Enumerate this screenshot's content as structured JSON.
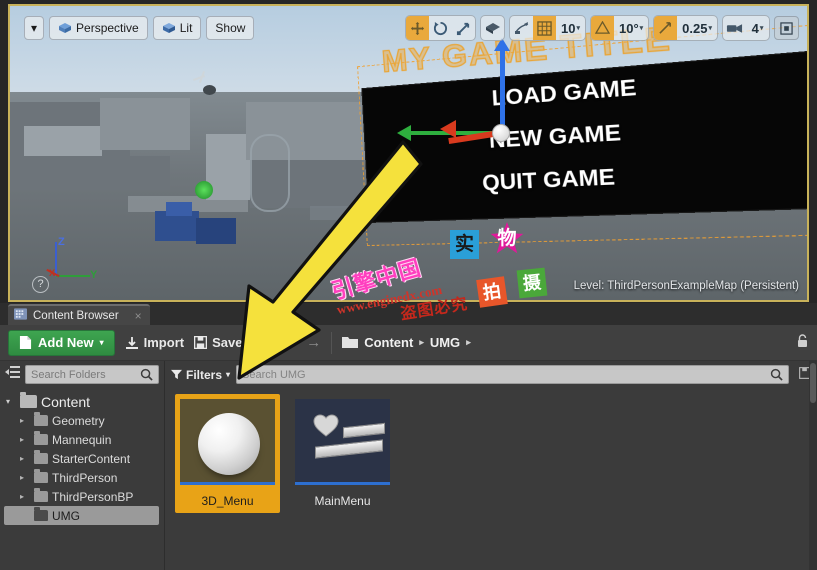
{
  "viewport": {
    "toolbar_left": {
      "dropdown_label": "▾",
      "perspective_label": "Perspective",
      "lit_label": "Lit",
      "show_label": "Show"
    },
    "toolbar_right": {
      "select_mode_icon": "move-tool-icon",
      "rotate_icon": "rotate-tool-icon",
      "scale_icon": "scale-tool-icon",
      "coord_space_icon": "world-space-icon",
      "surface_snap_icon": "surface-snap-icon",
      "grid_snap_icon": "grid-snap-icon",
      "grid_snap_value": "10",
      "angle_snap_icon": "angle-snap-icon",
      "angle_snap_value": "10°",
      "scale_snap_icon": "scale-snap-icon",
      "scale_snap_value": "0.25",
      "camera_speed_icon": "camera-speed-icon",
      "camera_speed_value": "4",
      "maximize_icon": "maximize-viewport-icon"
    },
    "widget": {
      "title": "MY GAME TITLE",
      "items": [
        "LOAD GAME",
        "NEW GAME",
        "QUIT GAME"
      ]
    },
    "axis_indicator": {
      "z": "Z",
      "y": "Y",
      "x": "X"
    },
    "help_icon": "?",
    "level_label": "Level:  ThirdPersonExampleMap (Persistent)"
  },
  "content_browser": {
    "tab": {
      "label": "Content Browser",
      "icon": "content-browser-icon",
      "close": "×"
    },
    "toolbar": {
      "add_new_label": "Add New",
      "add_new_caret": "▾",
      "import_label": "Import",
      "save_all_label": "Save All",
      "back_arrow": "←",
      "forward_arrow": "→",
      "lock_icon": "lock-icon"
    },
    "breadcrumb": {
      "folder_icon": "folder-icon",
      "items": [
        "Content",
        "UMG"
      ],
      "separator": "▸"
    },
    "folder_pane": {
      "expand_icon": "expand-tree-icon",
      "search_placeholder": "Search Folders",
      "search_icon": "search-icon",
      "tree": [
        {
          "label": "Content",
          "level": 0,
          "arrow": "▾",
          "selected": false
        },
        {
          "label": "Geometry",
          "level": 1,
          "arrow": "▸",
          "selected": false
        },
        {
          "label": "Mannequin",
          "level": 1,
          "arrow": "▸",
          "selected": false
        },
        {
          "label": "StarterContent",
          "level": 1,
          "arrow": "▸",
          "selected": false
        },
        {
          "label": "ThirdPerson",
          "level": 1,
          "arrow": "▸",
          "selected": false
        },
        {
          "label": "ThirdPersonBP",
          "level": 1,
          "arrow": "▸",
          "selected": false
        },
        {
          "label": "UMG",
          "level": 1,
          "arrow": "",
          "selected": true
        }
      ]
    },
    "asset_pane": {
      "filters_label": "Filters",
      "filters_caret": "▾",
      "filters_icon": "filter-icon",
      "search_placeholder": "Search UMG",
      "search_icon": "search-icon",
      "save_search_icon": "save-search-icon",
      "assets": [
        {
          "name": "3D_Menu",
          "thumb": "sphere-thumbnail",
          "selected": true
        },
        {
          "name": "MainMenu",
          "thumb": "widget-blueprint-thumbnail",
          "selected": false
        }
      ]
    }
  },
  "annotations": {
    "arrow": "yellow-callout-arrow",
    "watermark_cn": "引擎中国",
    "watermark_url": "www.enginedx.com",
    "watermark_red": "盗图必究",
    "badge_pai": "拍",
    "badge_she": "摄",
    "char_shi": "实",
    "char_wu": "物"
  },
  "colors": {
    "accent_orange": "#e8a317",
    "green_button": "#3ea550",
    "viewport_border": "#c8b25a",
    "arrow_yellow": "#f5e13c"
  }
}
